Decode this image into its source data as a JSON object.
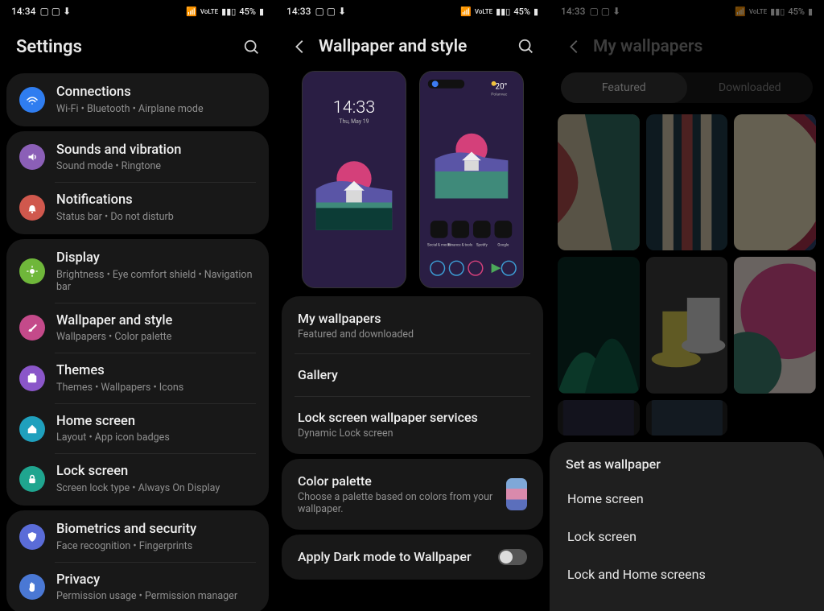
{
  "screens": [
    {
      "statusbar": {
        "time": "14:34",
        "net": "VoLTE",
        "battery": "45%"
      },
      "title": "Settings",
      "groups": [
        {
          "items": [
            {
              "icon": "wifi",
              "bg": "#2f7df0",
              "title": "Connections",
              "sub": "Wi-Fi  •  Bluetooth  •  Airplane mode"
            }
          ]
        },
        {
          "items": [
            {
              "icon": "sound",
              "bg": "#8b5fb7",
              "title": "Sounds and vibration",
              "sub": "Sound mode  •  Ringtone"
            },
            {
              "icon": "bell",
              "bg": "#d0584d",
              "title": "Notifications",
              "sub": "Status bar  •  Do not disturb"
            }
          ]
        },
        {
          "items": [
            {
              "icon": "sun",
              "bg": "#6fb73a",
              "title": "Display",
              "sub": "Brightness  •  Eye comfort shield  •  Navigation bar"
            },
            {
              "icon": "brush",
              "bg": "#c44a8a",
              "title": "Wallpaper and style",
              "sub": "Wallpapers  •  Color palette"
            },
            {
              "icon": "themes",
              "bg": "#8a56c9",
              "title": "Themes",
              "sub": "Themes  •  Wallpapers  •  Icons"
            },
            {
              "icon": "home",
              "bg": "#1fa0bd",
              "title": "Home screen",
              "sub": "Layout  •  App icon badges"
            },
            {
              "icon": "lock",
              "bg": "#1fa58f",
              "title": "Lock screen",
              "sub": "Screen lock type  •  Always On Display"
            }
          ]
        },
        {
          "items": [
            {
              "icon": "shield",
              "bg": "#5a6cd8",
              "title": "Biometrics and security",
              "sub": "Face recognition  •  Fingerprints"
            },
            {
              "icon": "hand",
              "bg": "#4a78d4",
              "title": "Privacy",
              "sub": "Permission usage  •  Permission manager"
            }
          ]
        }
      ]
    },
    {
      "statusbar": {
        "time": "14:33",
        "net": "VoLTE",
        "battery": "45%"
      },
      "title": "Wallpaper and style",
      "preview": {
        "clock": "14:33",
        "date": "Thu, May 19",
        "weather": "20°",
        "city": "Polanvac"
      },
      "lists": [
        {
          "items": [
            {
              "title": "My wallpapers",
              "sub": "Featured and downloaded"
            },
            {
              "title": "Gallery"
            },
            {
              "title": "Lock screen wallpaper services",
              "sub": "Dynamic Lock screen"
            }
          ]
        },
        {
          "items": [
            {
              "title": "Color palette",
              "sub": "Choose a palette based on colors from your wallpaper.",
              "chip": true
            }
          ]
        },
        {
          "items": [
            {
              "title": "Apply Dark mode to Wallpaper",
              "toggle": true
            }
          ]
        }
      ]
    },
    {
      "statusbar": {
        "time": "14:33",
        "net": "VoLTE",
        "battery": "45%"
      },
      "title": "My wallpapers",
      "tabs": [
        {
          "label": "Featured",
          "active": true
        },
        {
          "label": "Downloaded",
          "active": false
        }
      ],
      "sheet": {
        "title": "Set as wallpaper",
        "options": [
          "Home screen",
          "Lock screen",
          "Lock and Home screens"
        ]
      }
    }
  ]
}
